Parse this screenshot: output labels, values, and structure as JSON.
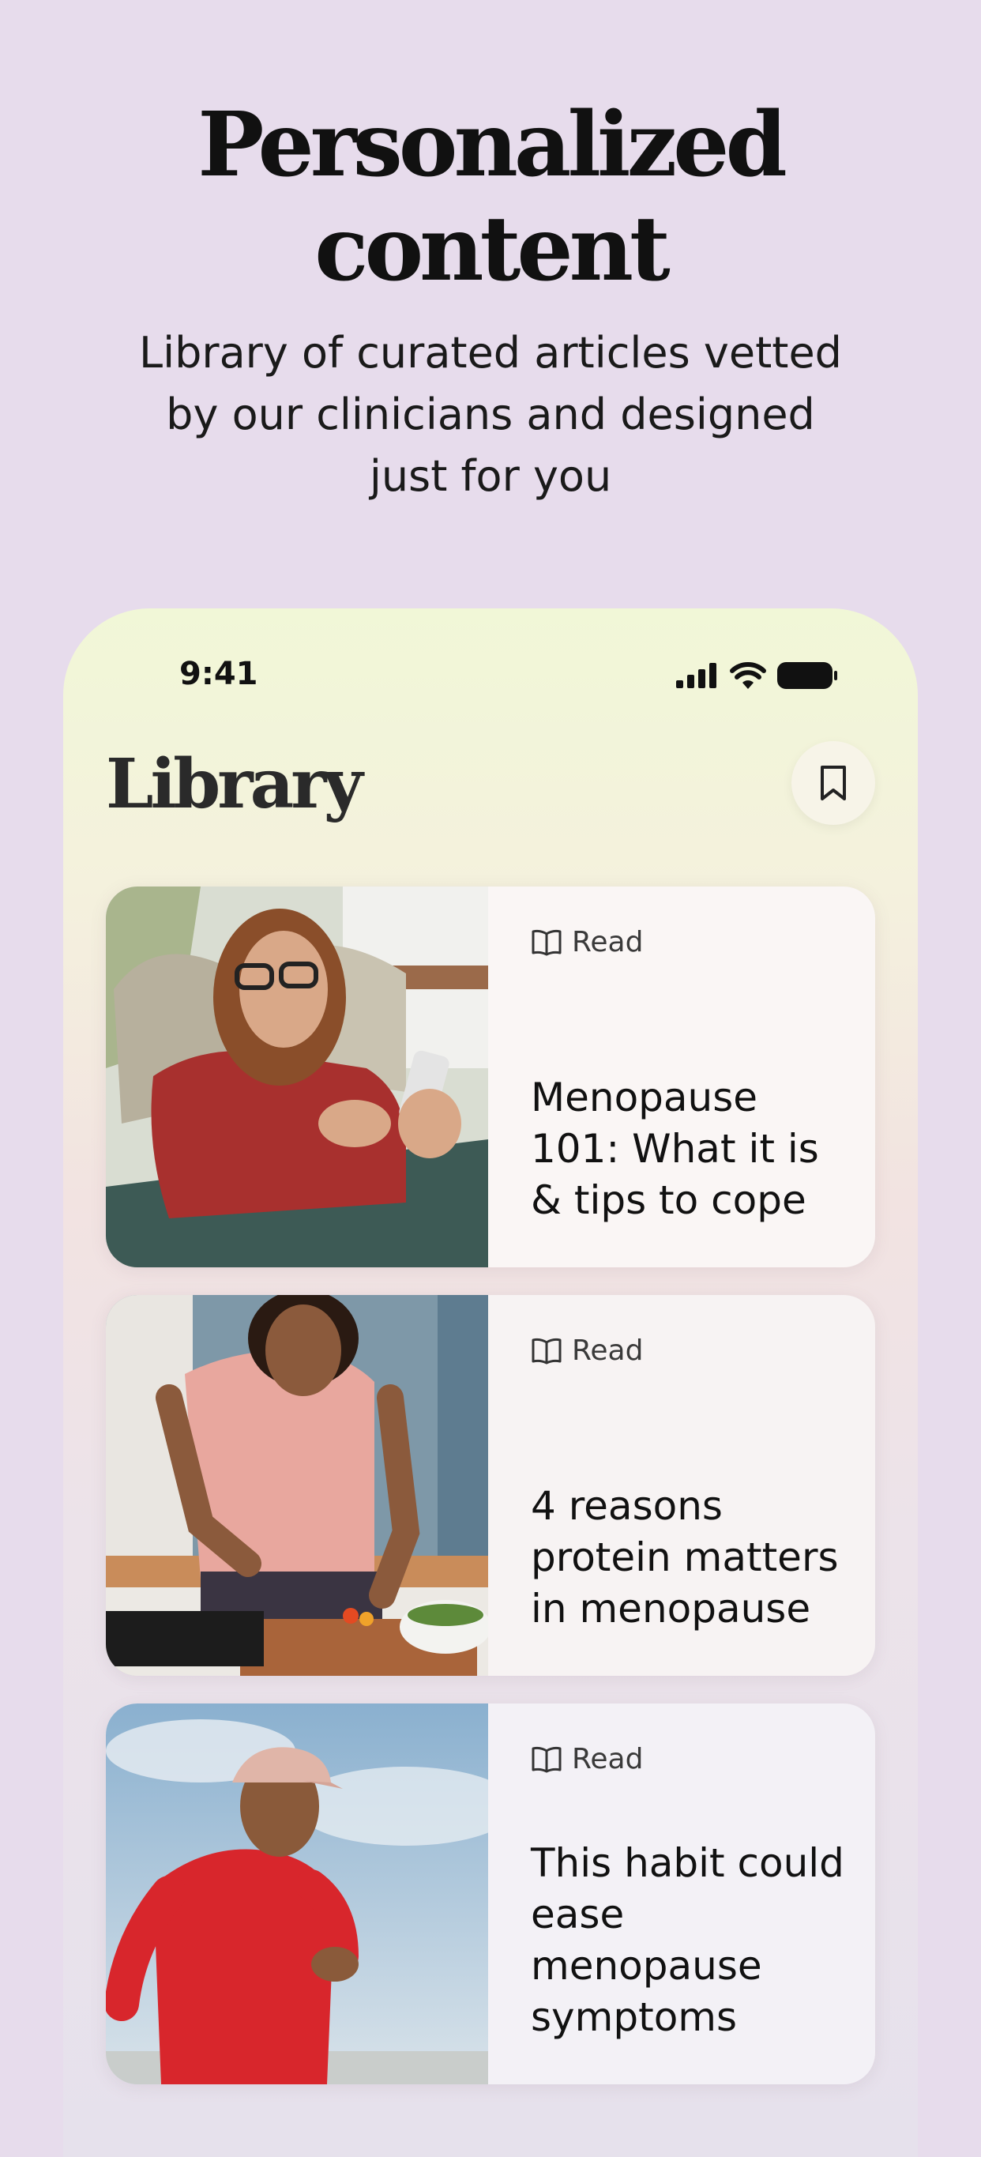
{
  "hero": {
    "title_line1": "Personalized",
    "title_line2": "content",
    "subtitle": "Library of curated articles vetted by our clinicians and designed just for you"
  },
  "status_bar": {
    "time": "9:41",
    "icons": [
      "signal-icon",
      "wifi-icon",
      "battery-icon"
    ]
  },
  "library": {
    "title": "Library",
    "bookmark_icon": "bookmark-icon",
    "articles": [
      {
        "tag": "Read",
        "title": "Menopause 101: What it is & tips to cope"
      },
      {
        "tag": "Read",
        "title": "4 reasons protein matters in menopause"
      },
      {
        "tag": "Read",
        "title": "This habit could ease menopause symptoms"
      }
    ]
  },
  "colors": {
    "background": "#e7dcec",
    "text": "#111111"
  }
}
